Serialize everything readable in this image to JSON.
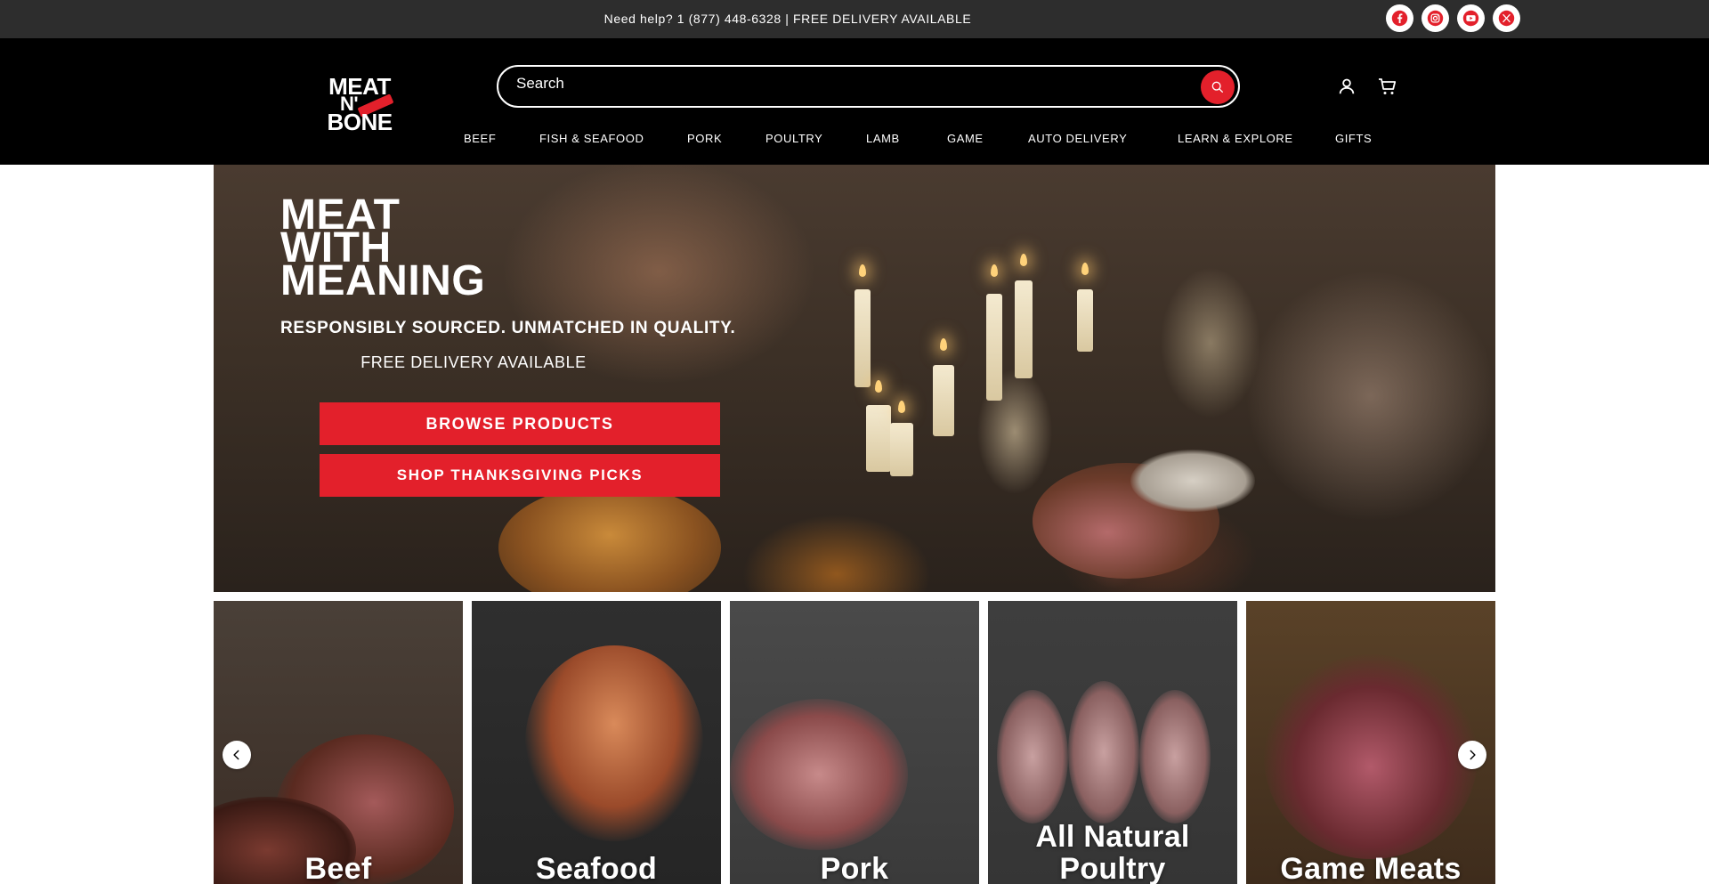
{
  "topbar": {
    "help_text": "Need help? 1 (877) 448-6328 | FREE DELIVERY AVAILABLE",
    "social": [
      "facebook-icon",
      "instagram-icon",
      "youtube-icon",
      "x-icon"
    ]
  },
  "header": {
    "logo": {
      "line1": "MEAT",
      "line2": "N'",
      "line3": "BONE"
    },
    "search": {
      "placeholder": "Search"
    },
    "icons": [
      "account-icon",
      "cart-icon"
    ],
    "nav": [
      "BEEF",
      "FISH & SEAFOOD",
      "PORK",
      "POULTRY",
      "LAMB",
      "GAME",
      "AUTO DELIVERY",
      "LEARN & EXPLORE",
      "GIFTS"
    ]
  },
  "hero": {
    "title_line1": "MEAT",
    "title_line2": "WITH",
    "title_line3": "MEANING",
    "subtitle": "RESPONSIBLY SOURCED. UNMATCHED IN QUALITY.",
    "delivery": "FREE DELIVERY AVAILABLE",
    "buttons": [
      "BROWSE PRODUCTS",
      "SHOP THANKSGIVING PICKS"
    ]
  },
  "categories": [
    {
      "label": "Beef"
    },
    {
      "label": "Seafood"
    },
    {
      "label": "Pork"
    },
    {
      "label": "All Natural Poultry"
    },
    {
      "label": "Game Meats"
    }
  ],
  "colors": {
    "brand_red": "#e3202b",
    "topbar": "#2d2d2d",
    "header": "#000000"
  }
}
